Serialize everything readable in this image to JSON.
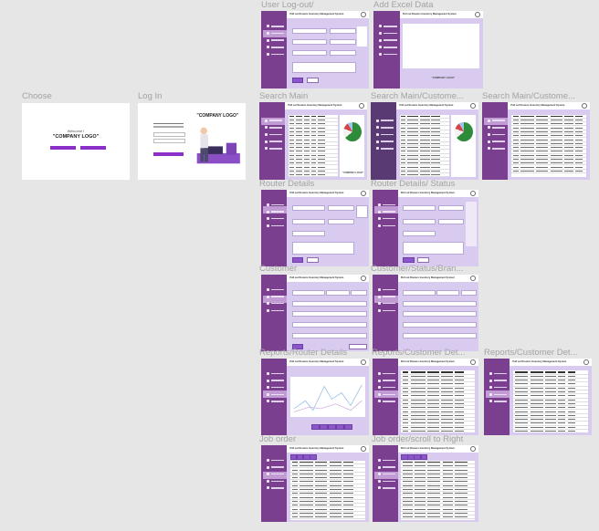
{
  "frames": [
    {
      "label": "User Log-out/",
      "kind": "form"
    },
    {
      "label": "Add Excel Data",
      "kind": "excel"
    },
    {
      "label": "Choose",
      "kind": "choose"
    },
    {
      "label": "Log In",
      "kind": "login"
    },
    {
      "label": "Search Main",
      "kind": "search"
    },
    {
      "label": "Search Main/Custome...",
      "kind": "search"
    },
    {
      "label": "Search Main/Custome...",
      "kind": "table"
    },
    {
      "label": "Router Details",
      "kind": "form"
    },
    {
      "label": "Router Details/ Status",
      "kind": "form"
    },
    {
      "label": "Customer",
      "kind": "form"
    },
    {
      "label": "Customer/Status/Bran...",
      "kind": "form"
    },
    {
      "label": "Reports/Router Details",
      "kind": "chart"
    },
    {
      "label": "Reports/Customer Det...",
      "kind": "table"
    },
    {
      "label": "Reports/Customer Det...",
      "kind": "table"
    },
    {
      "label": "Job order",
      "kind": "table"
    },
    {
      "label": "Job order/scroll to Right",
      "kind": "table"
    }
  ],
  "app": {
    "title": "Pull out Routers Inventory Management System"
  },
  "choose": {
    "welcome": "Welcome !",
    "logo": "\"COMPANY LOGO\""
  },
  "login": {
    "logo": "\"COMPANY LOGO\""
  },
  "excel": {
    "logo": "\"COMPANY LOGO\""
  },
  "search": {
    "logo": "\"COMPANY LOGO\""
  },
  "colors": {
    "canvas": "#e6e6e6",
    "sidebar": "#7a3f8e",
    "content": "#d9cbf0",
    "accent": "#8b2fc9"
  }
}
